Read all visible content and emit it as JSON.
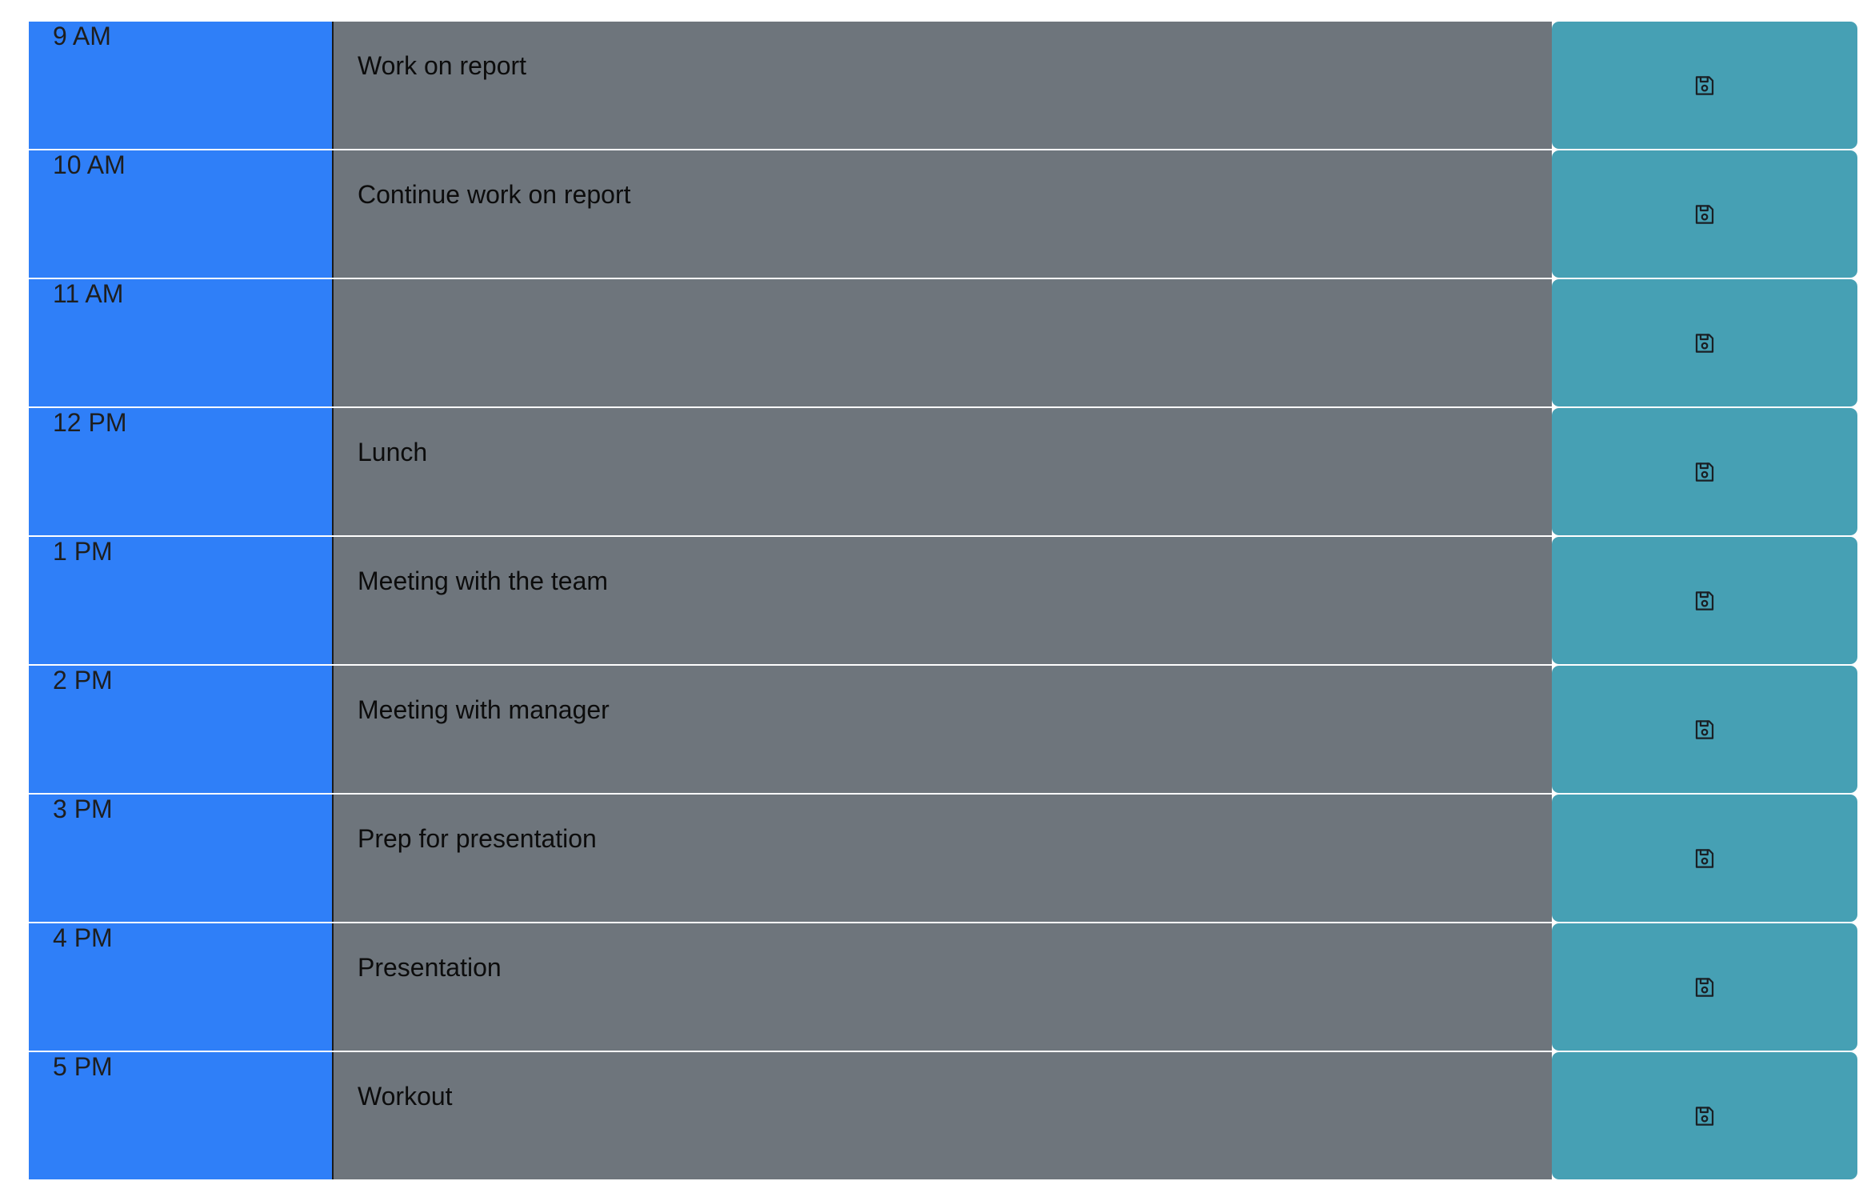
{
  "colors": {
    "hour_bg": "#2f7ff8",
    "past_bg": "#6e757c",
    "save_bg": "#46a0b4",
    "icon_stroke": "#1a1f24"
  },
  "save_icon": "floppy-disk-save-icon",
  "rows": [
    {
      "hour": "9 AM",
      "description": "Work on report"
    },
    {
      "hour": "10 AM",
      "description": "Continue work on report"
    },
    {
      "hour": "11 AM",
      "description": ""
    },
    {
      "hour": "12 PM",
      "description": "Lunch"
    },
    {
      "hour": "1 PM",
      "description": "Meeting with the team"
    },
    {
      "hour": "2 PM",
      "description": "Meeting with manager"
    },
    {
      "hour": "3 PM",
      "description": "Prep for presentation"
    },
    {
      "hour": "4 PM",
      "description": "Presentation"
    },
    {
      "hour": "5 PM",
      "description": "Workout"
    }
  ]
}
